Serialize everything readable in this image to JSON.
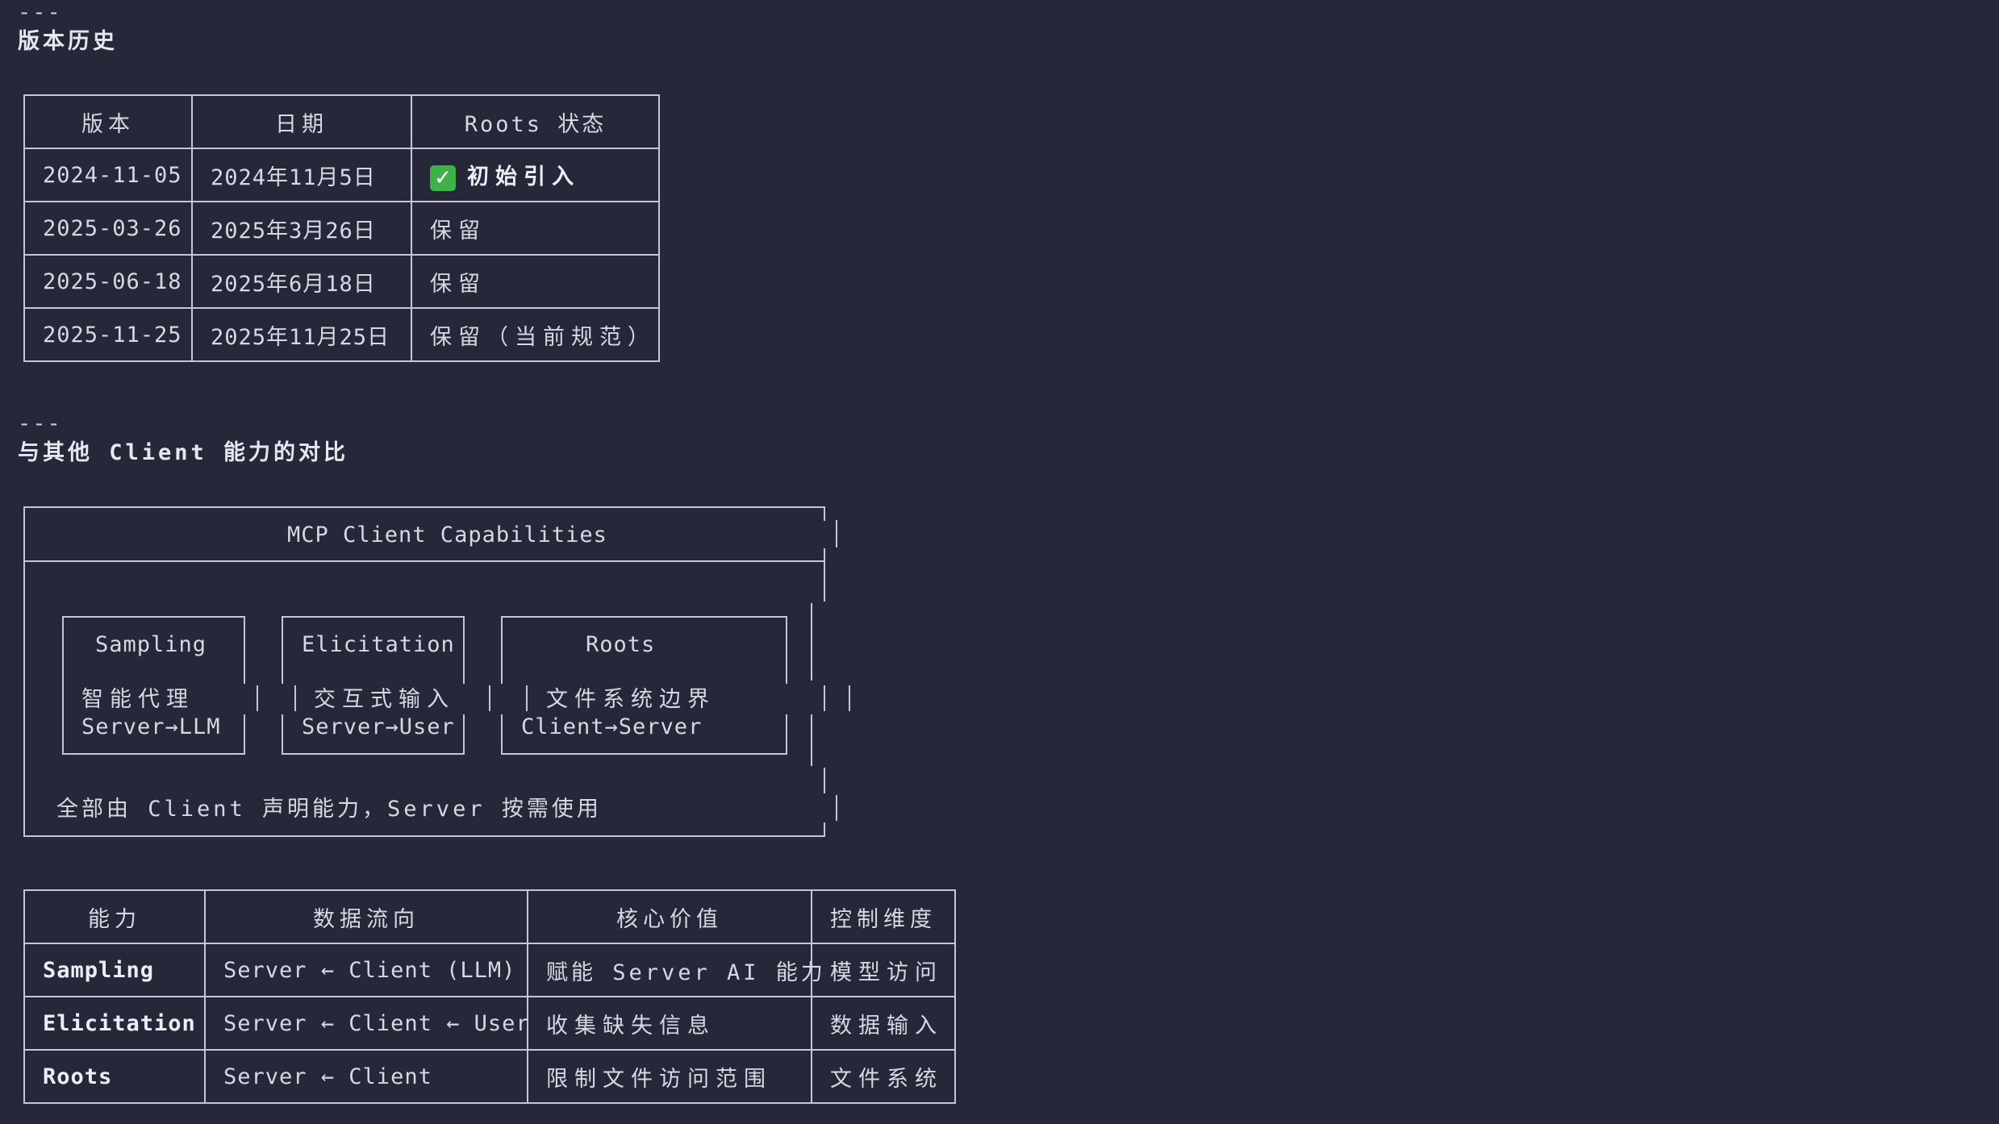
{
  "sections": {
    "separator": "---",
    "version_history_title": "版本历史",
    "comparison_title": "与其他 Client 能力的对比"
  },
  "version_table": {
    "headers": [
      "版本",
      "日期",
      "Roots 状态"
    ],
    "rows": [
      {
        "version": "2024-11-05",
        "date": "2024年11月5日",
        "status": "初始引入",
        "status_icon": "check-mark-icon",
        "status_icon_glyph": "✓"
      },
      {
        "version": "2025-03-26",
        "date": "2025年3月26日",
        "status": "保留"
      },
      {
        "version": "2025-06-18",
        "date": "2025年6月18日",
        "status": "保留"
      },
      {
        "version": "2025-11-25",
        "date": "2025年11月25日",
        "status": "保留（当前规范）"
      }
    ]
  },
  "diagram": {
    "title": "MCP Client Capabilities",
    "capabilities": [
      {
        "name": "Sampling",
        "desc": "智能代理",
        "flow": "Server→LLM"
      },
      {
        "name": "Elicitation",
        "desc": "交互式输入",
        "flow": "Server→User"
      },
      {
        "name": "Roots",
        "desc": "文件系统边界",
        "flow": "Client→Server"
      }
    ],
    "footer": "全部由 Client 声明能力，Server 按需使用"
  },
  "comparison_table": {
    "headers": [
      "能力",
      "数据流向",
      "核心价值",
      "控制维度"
    ],
    "rows": [
      {
        "name": "Sampling",
        "flow": "Server ← Client (LLM)",
        "value": "赋能 Server AI 能力",
        "dimension": "模型访问"
      },
      {
        "name": "Elicitation",
        "flow": "Server ← Client ← User",
        "value": "收集缺失信息",
        "dimension": "数据输入"
      },
      {
        "name": "Roots",
        "flow": "Server ← Client",
        "value": "限制文件访问范围",
        "dimension": "文件系统"
      }
    ]
  },
  "colors": {
    "background": "#262839",
    "text": "#d6d8e2",
    "border": "#c4c6d8",
    "check": "#3fb04a"
  }
}
